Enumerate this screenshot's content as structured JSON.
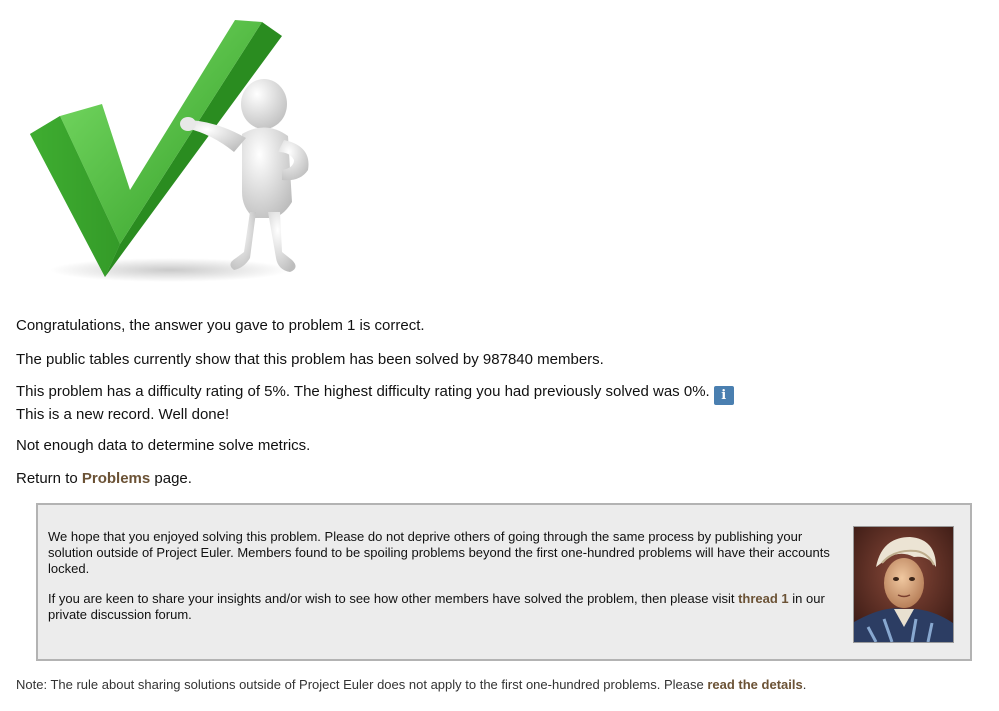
{
  "result": {
    "congrats": "Congratulations, the answer you gave to problem 1 is correct.",
    "solved_by": "The public tables currently show that this problem has been solved by 987840 members.",
    "difficulty": "This problem has a difficulty rating of 5%. The highest difficulty rating you had previously solved was 0%.",
    "info_badge": "i",
    "new_record": "This is a new record. Well done!",
    "metrics": "Not enough data to determine solve metrics.",
    "return_prefix": "Return to ",
    "return_link": "Problems",
    "return_suffix": " page."
  },
  "notice": {
    "paragraph1": "We hope that you enjoyed solving this problem. Please do not deprive others of going through the same process by publishing your solution outside of Project Euler. Members found to be spoiling problems beyond the first one-hundred problems will have their accounts locked.",
    "paragraph2_prefix": "If you are keen to share your insights and/or wish to see how other members have solved the problem, then please visit ",
    "thread_link": "thread 1",
    "paragraph2_suffix": " in our private discussion forum."
  },
  "footer": {
    "note_prefix": "Note: The rule about sharing solutions outside of Project Euler does not apply to the first one-hundred problems. Please ",
    "note_link": "read the details",
    "note_suffix": "."
  },
  "colors": {
    "link": "#6b5235",
    "info_badge": "#4a7fb0",
    "checkmark": "#4cc03a",
    "notice_bg": "#ececec"
  },
  "icons": {
    "hero": "checkmark-figure-illustration",
    "info": "info-icon",
    "portrait": "euler-portrait"
  }
}
